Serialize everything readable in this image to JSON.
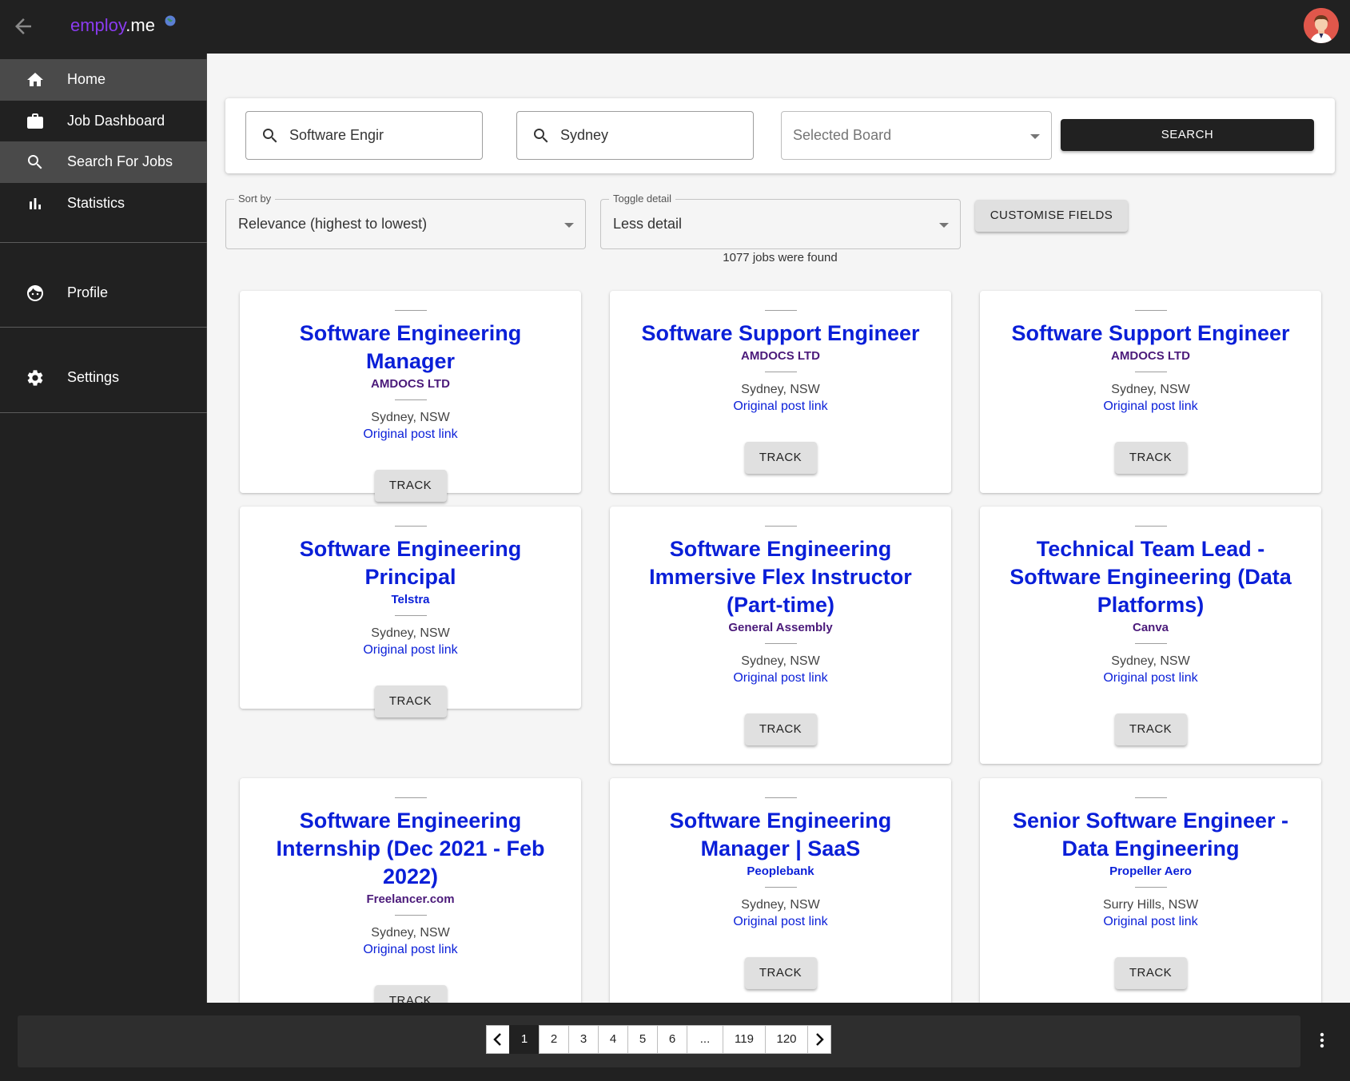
{
  "brand": {
    "part1": "employ",
    "part2": ".me"
  },
  "icons": {
    "back": "arrow-back-icon",
    "globe": "globe-icon",
    "avatar": "user-avatar",
    "search": "search-icon",
    "dropdown": "chevron-down-icon",
    "more": "more-vertical-icon"
  },
  "sidebar": {
    "items": [
      {
        "label": "Home",
        "icon": "home-icon"
      },
      {
        "label": "Job Dashboard",
        "icon": "briefcase-icon"
      },
      {
        "label": "Search For Jobs",
        "icon": "search-icon"
      },
      {
        "label": "Statistics",
        "icon": "bar-chart-icon"
      },
      {
        "label": "Profile",
        "icon": "face-icon"
      },
      {
        "label": "Settings",
        "icon": "gear-icon"
      }
    ]
  },
  "search": {
    "keyword": "Software Engir",
    "location": "Sydney",
    "board_placeholder": "Selected Board",
    "button": "SEARCH"
  },
  "filters": {
    "sort_label": "Sort by",
    "sort_value": "Relevance (highest to lowest)",
    "toggle_label": "Toggle detail",
    "toggle_value": "Less detail",
    "customise": "CUSTOMISE FIELDS",
    "count_text": "1077 jobs were found"
  },
  "jobs": [
    {
      "title": "Software Engineering Manager",
      "company": "AMDOCS LTD",
      "location": "Sydney, NSW",
      "link": "Original post link",
      "action": "TRACK"
    },
    {
      "title": "Software Support Engineer",
      "company": "AMDOCS LTD",
      "location": "Sydney, NSW",
      "link": "Original post link",
      "action": "TRACK"
    },
    {
      "title": "Software Support Engineer",
      "company": "AMDOCS LTD",
      "location": "Sydney, NSW",
      "link": "Original post link",
      "action": "TRACK"
    },
    {
      "title": "Software Engineering Principal",
      "company": "Telstra",
      "location": "Sydney, NSW",
      "link": "Original post link",
      "action": "TRACK"
    },
    {
      "title": "Software Engineering Immersive Flex Instructor (Part-time)",
      "company": "General Assembly",
      "location": "Sydney, NSW",
      "link": "Original post link",
      "action": "TRACK"
    },
    {
      "title": "Technical Team Lead - Software Engineering (Data Platforms)",
      "company": "Canva",
      "location": "Sydney, NSW",
      "link": "Original post link",
      "action": "TRACK"
    },
    {
      "title": "Software Engineering Internship (Dec 2021 - Feb 2022)",
      "company": "Freelancer.com",
      "location": "Sydney, NSW",
      "link": "Original post link",
      "action": "TRACK"
    },
    {
      "title": "Software Engineering Manager | SaaS",
      "company": "Peoplebank",
      "location": "Sydney, NSW",
      "link": "Original post link",
      "action": "TRACK"
    },
    {
      "title": "Senior Software Engineer - Data Engineering",
      "company": "Propeller Aero",
      "location": "Surry Hills, NSW",
      "link": "Original post link",
      "action": "TRACK"
    }
  ],
  "pagination": {
    "pages": [
      "1",
      "2",
      "3",
      "4",
      "5",
      "6",
      "...",
      "119",
      "120"
    ],
    "current": "1"
  },
  "colors": {
    "brand_purple": "#8a3bf0",
    "job_title_blue": "#0a1fd8",
    "company_purple": "#4b1a7a",
    "dark_bg": "#212121"
  }
}
